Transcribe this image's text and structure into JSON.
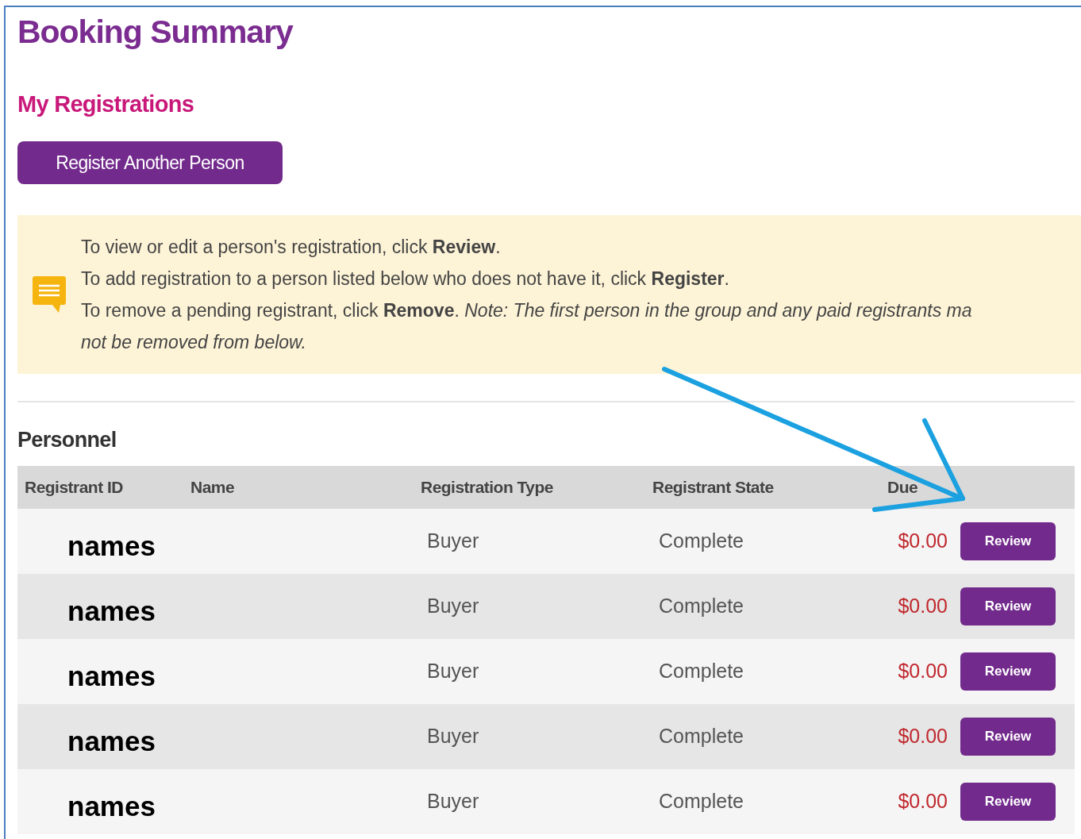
{
  "page": {
    "title": "Booking Summary",
    "subtitle": "My Registrations",
    "primary_button": "Register Another Person"
  },
  "notice": {
    "lines": [
      "To view or edit a person's registration, click **Review**.",
      "To add registration to a person listed below who does not have it, click **Register**.",
      "To remove a pending registrant, click **Remove**. *Note: The first person in the group and any paid registrants ma*",
      "*not be removed from below.*"
    ]
  },
  "personnel": {
    "heading": "Personnel",
    "columns": [
      "Registrant ID",
      "Name",
      "Registration Type",
      "Registrant State",
      "Due"
    ],
    "rows": [
      {
        "registrant_id": "names",
        "registration_type": "Buyer",
        "registrant_state": "Complete",
        "due": "$0.00",
        "action": "Review"
      },
      {
        "registrant_id": "names",
        "registration_type": "Buyer",
        "registrant_state": "Complete",
        "due": "$0.00",
        "action": "Review"
      },
      {
        "registrant_id": "names",
        "registration_type": "Buyer",
        "registrant_state": "Complete",
        "due": "$0.00",
        "action": "Review"
      },
      {
        "registrant_id": "names",
        "registration_type": "Buyer",
        "registrant_state": "Complete",
        "due": "$0.00",
        "action": "Review"
      },
      {
        "registrant_id": "names",
        "registration_type": "Buyer",
        "registrant_state": "Complete",
        "due": "$0.00",
        "action": "Review"
      }
    ]
  }
}
